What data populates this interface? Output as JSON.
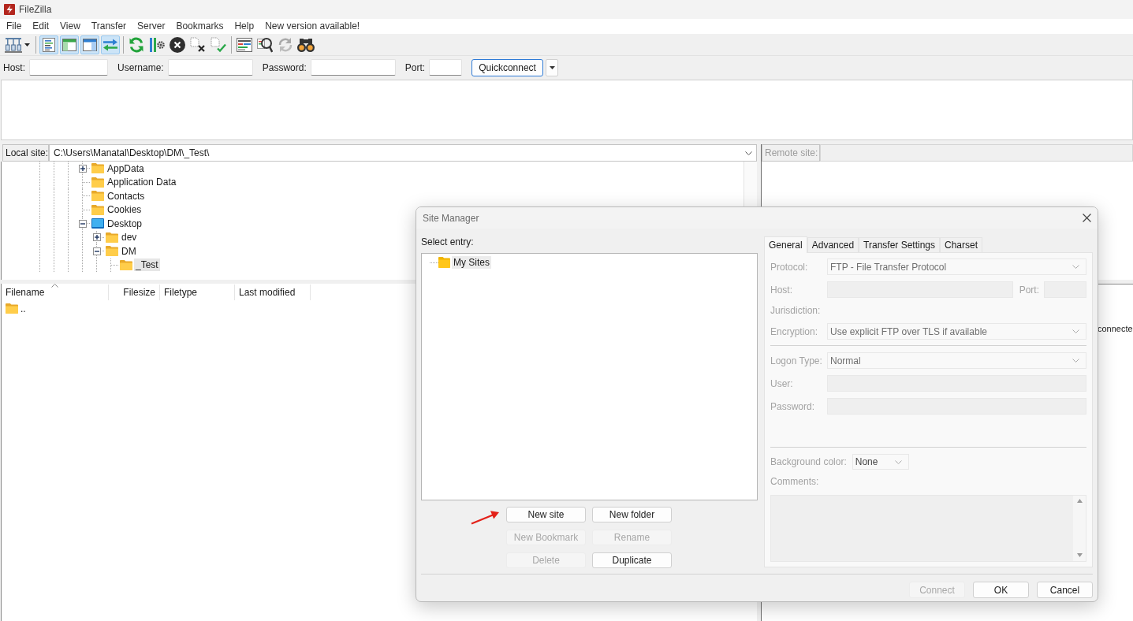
{
  "window": {
    "title": "FileZilla"
  },
  "menu": [
    "File",
    "Edit",
    "View",
    "Transfer",
    "Server",
    "Bookmarks",
    "Help",
    "New version available!"
  ],
  "toolbar": {
    "view_toggles": [
      {
        "on": true
      },
      {
        "on": true
      },
      {
        "on": true
      },
      {
        "on": true
      }
    ],
    "synchronized_browsing": {
      "disabled": true
    }
  },
  "quickconnect": {
    "fields": [
      {
        "label": "Host:"
      },
      {
        "label": "Username:"
      },
      {
        "label": "Password:"
      },
      {
        "label": "Port:"
      }
    ],
    "button": "Quickconnect"
  },
  "local_site": {
    "label": "Local site:",
    "path": "C:\\Users\\Manatal\\Desktop\\DM\\_Test\\",
    "tree": [
      {
        "label": "AppData",
        "kind": "folder",
        "expandable": true,
        "expanded": false,
        "selected": false
      },
      {
        "label": "Application Data",
        "kind": "folder",
        "expandable": false,
        "selected": false
      },
      {
        "label": "Contacts",
        "kind": "folder",
        "expandable": false,
        "selected": false
      },
      {
        "label": "Cookies",
        "kind": "folder",
        "expandable": false,
        "selected": false
      },
      {
        "label": "Desktop",
        "kind": "desktop",
        "expandable": true,
        "expanded": true,
        "selected": false,
        "children": [
          {
            "label": "dev",
            "kind": "folder",
            "expandable": true,
            "expanded": false,
            "selected": false
          },
          {
            "label": "DM",
            "kind": "folder",
            "expandable": true,
            "expanded": true,
            "selected": false,
            "children": [
              {
                "label": "_Test",
                "kind": "folder",
                "expandable": false,
                "selected": true
              }
            ]
          }
        ]
      }
    ],
    "file_list": {
      "columns": [
        {
          "label": "Filename",
          "sorted": true
        },
        {
          "label": "Filesize",
          "sorted": false
        },
        {
          "label": "Filetype",
          "sorted": false
        },
        {
          "label": "Last modified",
          "sorted": false
        }
      ],
      "rows": [
        {
          "name": ".."
        }
      ]
    }
  },
  "remote_site": {
    "label": "Remote site:",
    "disabled": true,
    "message": "connecte"
  },
  "site_manager": {
    "title": "Site Manager",
    "select_entry_label": "Select entry:",
    "entries": [
      {
        "label": "My Sites",
        "selected": true
      }
    ],
    "entry_buttons": [
      {
        "label": "New site",
        "disabled": false
      },
      {
        "label": "New folder",
        "disabled": false
      },
      {
        "label": "New Bookmark",
        "disabled": true
      },
      {
        "label": "Rename",
        "disabled": true
      },
      {
        "label": "Delete",
        "disabled": true
      },
      {
        "label": "Duplicate",
        "disabled": false
      }
    ],
    "tabs": [
      {
        "label": "General",
        "selected": true
      },
      {
        "label": "Advanced",
        "selected": false
      },
      {
        "label": "Transfer Settings",
        "selected": false
      },
      {
        "label": "Charset",
        "selected": false
      }
    ],
    "general": {
      "disabled": true,
      "server": [
        {
          "kind": "select",
          "label": "Protocol:",
          "value": "FTP - File Transfer Protocol"
        },
        {
          "kind": "host",
          "label": "Host:",
          "port_label": "Port:"
        },
        {
          "kind": "label",
          "label": "Jurisdiction:"
        },
        {
          "kind": "select",
          "label": "Encryption:",
          "value": "Use explicit FTP over TLS if available"
        }
      ],
      "login": [
        {
          "kind": "select",
          "label": "Logon Type:",
          "value": "Normal"
        },
        {
          "kind": "input",
          "label": "User:"
        },
        {
          "kind": "input",
          "label": "Password:"
        }
      ],
      "background_color": {
        "label": "Background color:",
        "value": "None"
      },
      "comments": {
        "label": "Comments:"
      }
    },
    "footer_buttons": [
      {
        "label": "Connect",
        "disabled": true
      },
      {
        "label": "OK",
        "disabled": false
      },
      {
        "label": "Cancel",
        "disabled": false
      }
    ]
  }
}
